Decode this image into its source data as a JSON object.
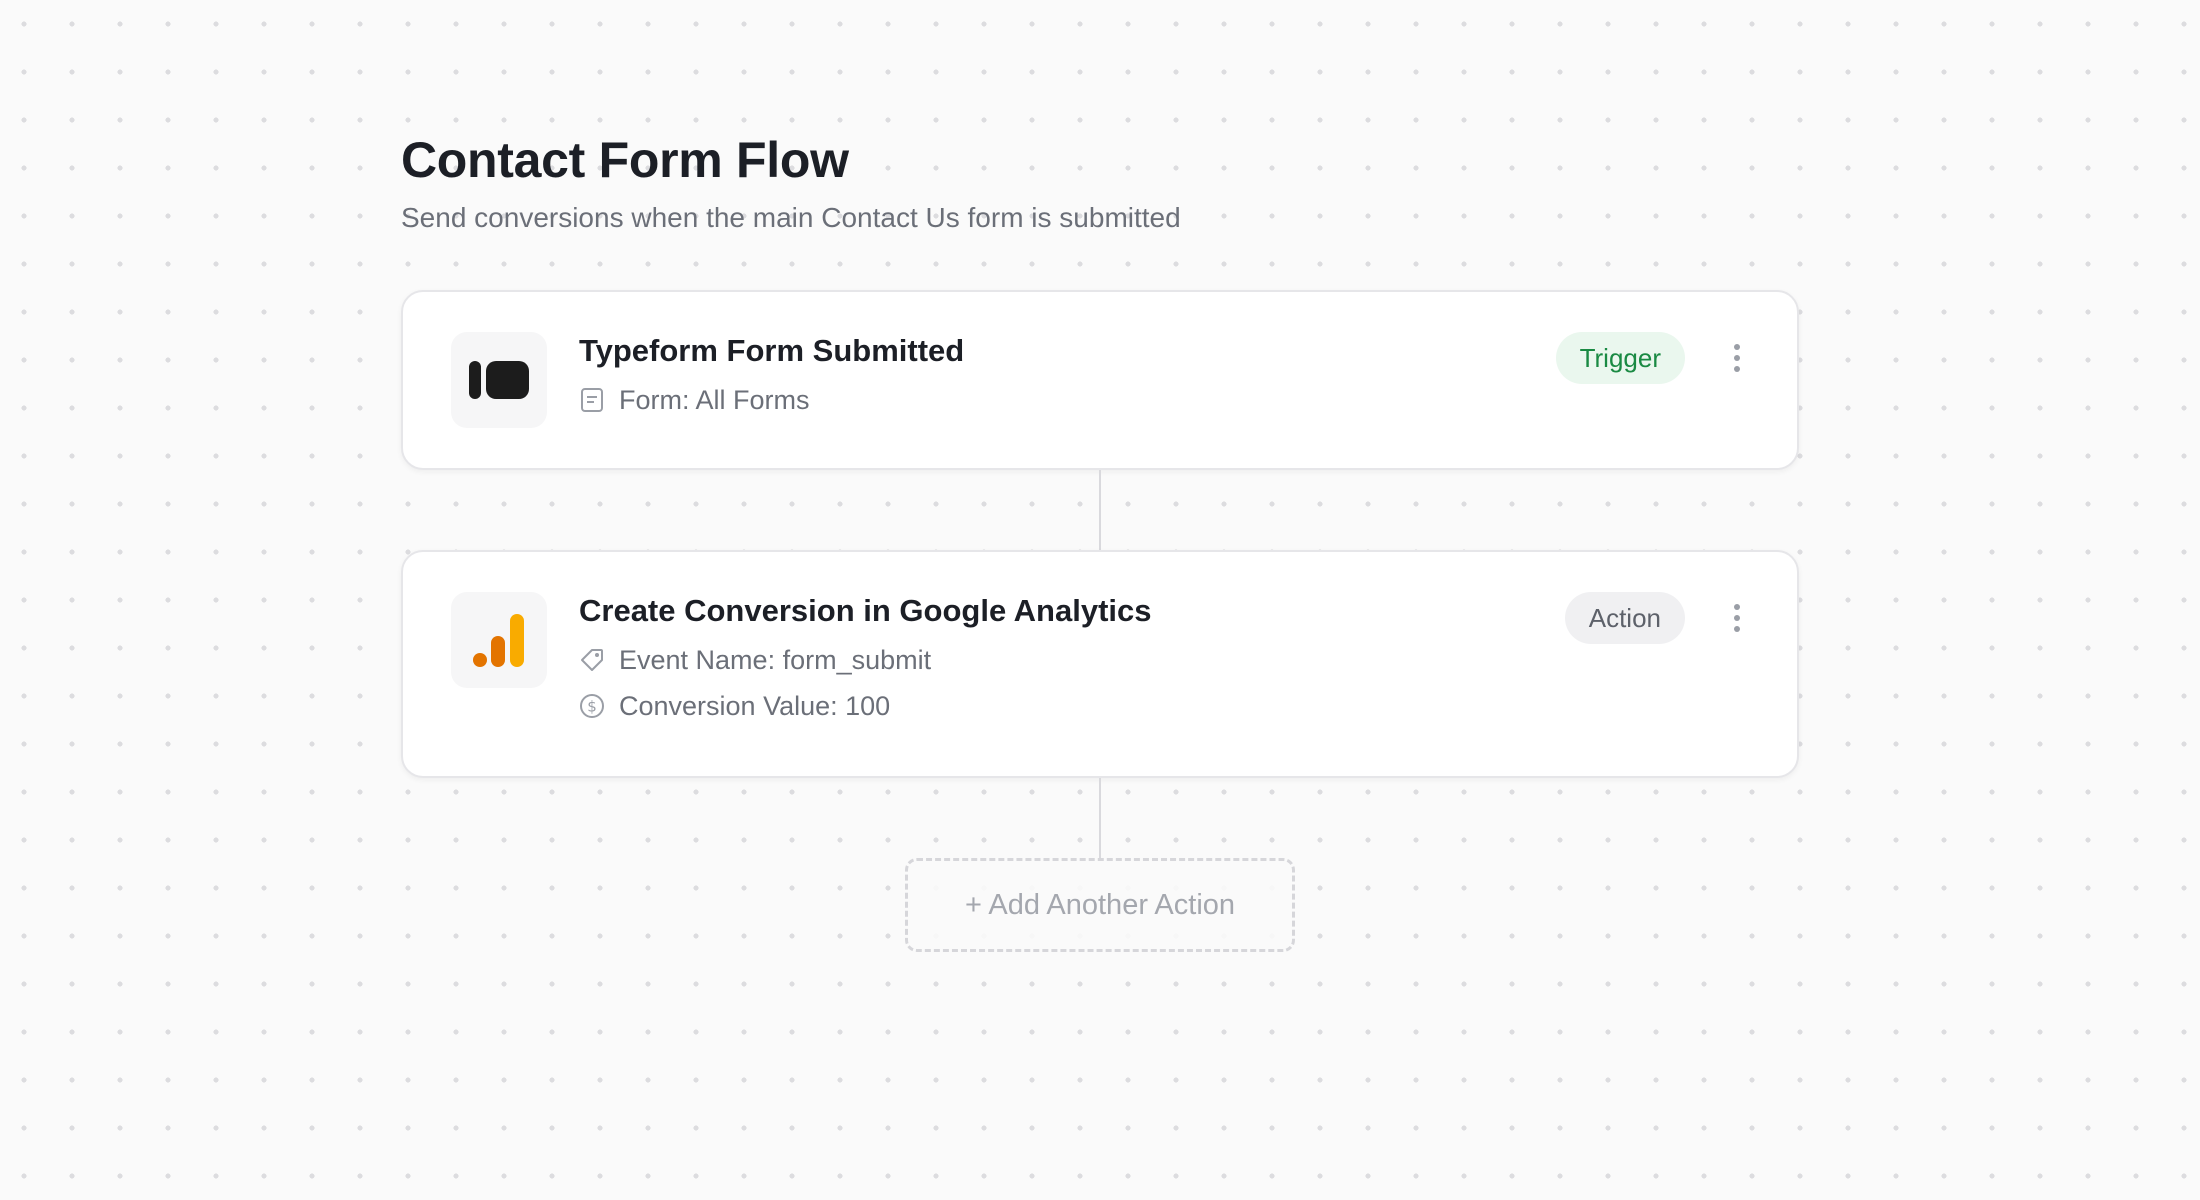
{
  "flow": {
    "title": "Contact Form Flow",
    "subtitle": "Send conversions when the main Contact Us form is submitted"
  },
  "steps": [
    {
      "app_icon": "typeform-logo-icon",
      "title": "Typeform Form Submitted",
      "badge": "Trigger",
      "details": [
        {
          "icon": "form-document-icon",
          "text": "Form: All Forms"
        }
      ]
    },
    {
      "app_icon": "google-analytics-logo-icon",
      "title": "Create Conversion in Google Analytics",
      "badge": "Action",
      "details": [
        {
          "icon": "tag-icon",
          "text": "Event Name: form_submit"
        },
        {
          "icon": "dollar-circle-icon",
          "text": "Conversion Value: 100"
        }
      ]
    }
  ],
  "add_action": {
    "label": "+ Add Another Action"
  },
  "colors": {
    "trigger_badge_bg": "#eaf7ee",
    "trigger_badge_text": "#1a8a43",
    "action_badge_bg": "#f0f0f2",
    "ga_orange_dark": "#e37400",
    "ga_orange_light": "#f9ab00"
  }
}
